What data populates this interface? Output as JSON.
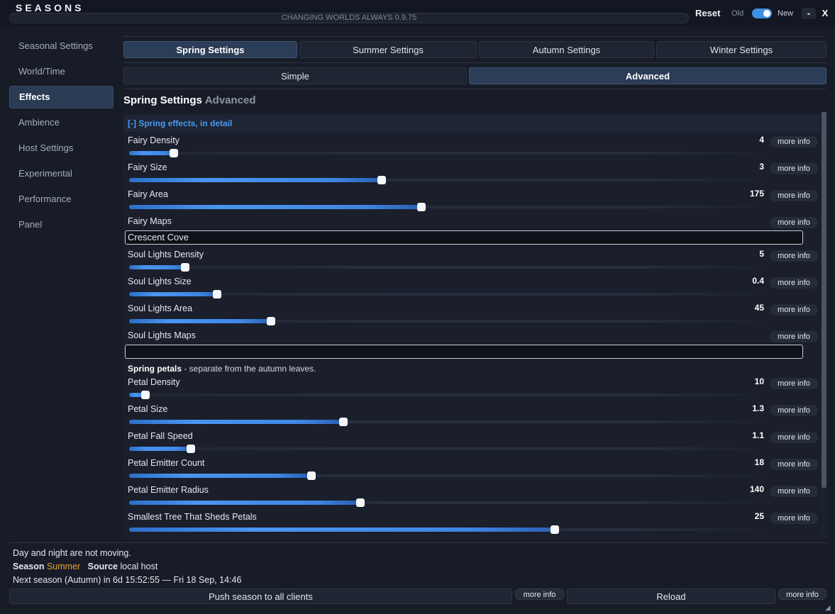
{
  "window": {
    "title": "SEASONS",
    "version": "CHANGING WORLDS ALWAYS  0.9.75",
    "reset_label": "Reset",
    "old_label": "Old",
    "new_label": "New",
    "toggle_on": true,
    "minimize_label": "-",
    "close_label": "X"
  },
  "sidebar": {
    "items": [
      {
        "label": "Seasonal Settings"
      },
      {
        "label": "World/Time"
      },
      {
        "label": "Effects",
        "active": true
      },
      {
        "label": "Ambience"
      },
      {
        "label": "Host Settings"
      },
      {
        "label": "Experimental"
      },
      {
        "label": "Performance"
      },
      {
        "label": "Panel"
      }
    ]
  },
  "season_tabs": [
    {
      "label": "Spring Settings",
      "active": true
    },
    {
      "label": "Summer Settings"
    },
    {
      "label": "Autumn Settings"
    },
    {
      "label": "Winter Settings"
    }
  ],
  "mode_tabs": [
    {
      "label": "Simple"
    },
    {
      "label": "Advanced",
      "active": true
    }
  ],
  "section": {
    "title": "Spring Settings",
    "subtitle": "Advanced"
  },
  "group": {
    "toggle": "[-]",
    "title": "Spring effects, in detail"
  },
  "info_label": "more info",
  "settings": [
    {
      "label": "Fairy Density",
      "value": "4",
      "fraction": 0.07
    },
    {
      "label": "Fairy Size",
      "value": "3",
      "fraction": 0.395
    },
    {
      "label": "Fairy Area",
      "value": "175",
      "fraction": 0.458
    },
    {
      "label": "Fairy Maps",
      "text_value": "Crescent Cove"
    },
    {
      "label": "Soul Lights Density",
      "value": "5",
      "fraction": 0.088
    },
    {
      "label": "Soul Lights Size",
      "value": "0.4",
      "fraction": 0.138
    },
    {
      "label": "Soul Lights Area",
      "value": "45",
      "fraction": 0.222
    },
    {
      "label": "Soul Lights Maps",
      "text_value": ""
    },
    {
      "label": "Petal Density",
      "value": "10",
      "fraction": 0.025
    },
    {
      "label": "Petal Size",
      "value": "1.3",
      "fraction": 0.335
    },
    {
      "label": "Petal Fall Speed",
      "value": "1.1",
      "fraction": 0.097
    },
    {
      "label": "Petal Emitter Count",
      "value": "18",
      "fraction": 0.285
    },
    {
      "label": "Petal Emitter Radius",
      "value": "140",
      "fraction": 0.362
    },
    {
      "label": "Smallest Tree That Sheds Petals",
      "value": "25",
      "fraction": 0.667
    }
  ],
  "petals_note": {
    "bold": "Spring petals",
    "text": " - separate from the autumn leaves."
  },
  "status": {
    "line1": "Day and night are not moving.",
    "season_label": "Season",
    "season_value": "Summer",
    "source_label": "Source",
    "source_value": "local host",
    "next_season": "Next season (Autumn) in 6d 15:52:55  —  Fri 18 Sep, 14:46"
  },
  "bottom": {
    "push_label": "Push season to all clients",
    "reload_label": "Reload",
    "info_label": "more info"
  }
}
